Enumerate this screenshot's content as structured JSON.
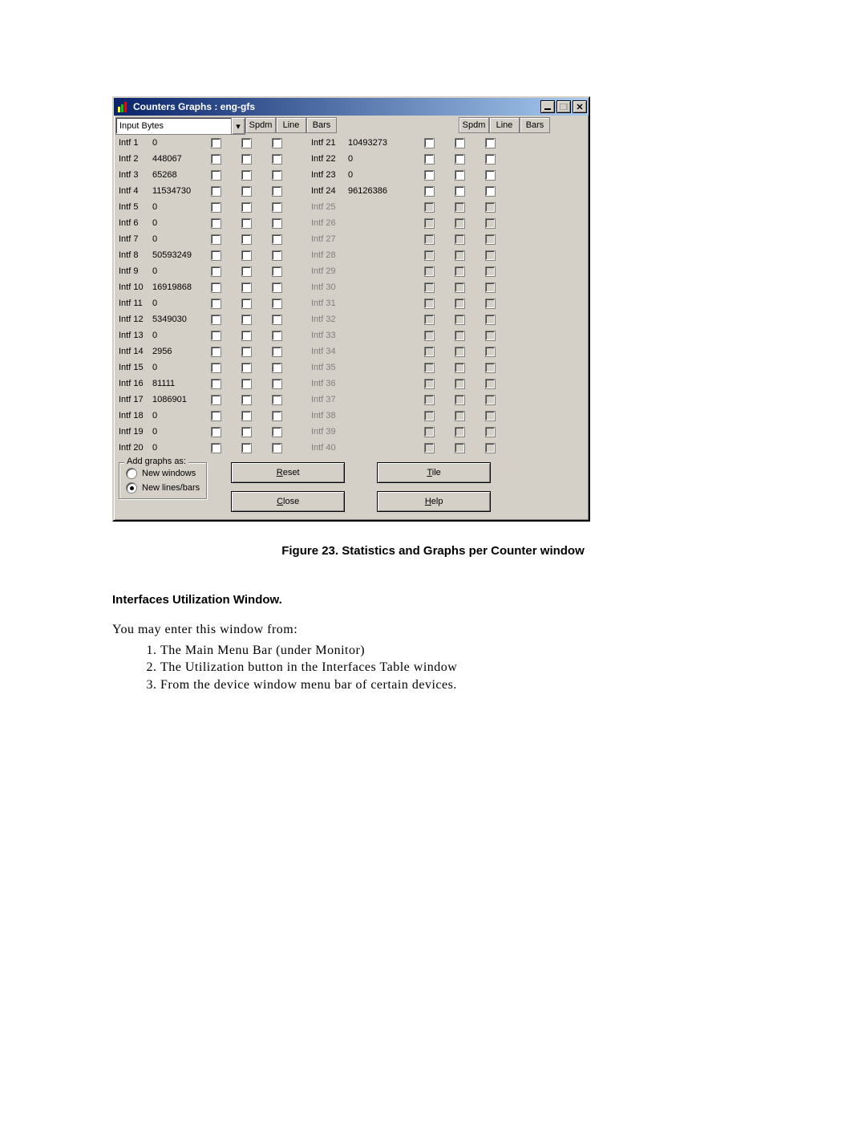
{
  "window": {
    "title": "Counters Graphs : eng-gfs",
    "dropdown_value": "Input Bytes",
    "headers": [
      "Spdm",
      "Line",
      "Bars",
      "Spdm",
      "Line",
      "Bars"
    ],
    "left_rows": [
      {
        "name": "Intf 1",
        "value": "0",
        "enabled": true
      },
      {
        "name": "Intf 2",
        "value": "448067",
        "enabled": true
      },
      {
        "name": "Intf 3",
        "value": "65268",
        "enabled": true
      },
      {
        "name": "Intf 4",
        "value": "11534730",
        "enabled": true
      },
      {
        "name": "Intf 5",
        "value": "0",
        "enabled": true
      },
      {
        "name": "Intf 6",
        "value": "0",
        "enabled": true
      },
      {
        "name": "Intf 7",
        "value": "0",
        "enabled": true
      },
      {
        "name": "Intf 8",
        "value": "50593249",
        "enabled": true
      },
      {
        "name": "Intf 9",
        "value": "0",
        "enabled": true
      },
      {
        "name": "Intf 10",
        "value": "16919868",
        "enabled": true
      },
      {
        "name": "Intf 11",
        "value": "0",
        "enabled": true
      },
      {
        "name": "Intf 12",
        "value": "5349030",
        "enabled": true
      },
      {
        "name": "Intf 13",
        "value": "0",
        "enabled": true
      },
      {
        "name": "Intf 14",
        "value": "2956",
        "enabled": true
      },
      {
        "name": "Intf 15",
        "value": "0",
        "enabled": true
      },
      {
        "name": "Intf 16",
        "value": "81111",
        "enabled": true
      },
      {
        "name": "Intf 17",
        "value": "1086901",
        "enabled": true
      },
      {
        "name": "Intf 18",
        "value": "0",
        "enabled": true
      },
      {
        "name": "Intf 19",
        "value": "0",
        "enabled": true
      },
      {
        "name": "Intf 20",
        "value": "0",
        "enabled": true
      }
    ],
    "right_rows": [
      {
        "name": "Intf 21",
        "value": "10493273",
        "enabled": true
      },
      {
        "name": "Intf 22",
        "value": "0",
        "enabled": true
      },
      {
        "name": "Intf 23",
        "value": "0",
        "enabled": true
      },
      {
        "name": "Intf 24",
        "value": "96126386",
        "enabled": true
      },
      {
        "name": "Intf 25",
        "value": "",
        "enabled": false
      },
      {
        "name": "Intf 26",
        "value": "",
        "enabled": false
      },
      {
        "name": "Intf 27",
        "value": "",
        "enabled": false
      },
      {
        "name": "Intf 28",
        "value": "",
        "enabled": false
      },
      {
        "name": "Intf 29",
        "value": "",
        "enabled": false
      },
      {
        "name": "Intf 30",
        "value": "",
        "enabled": false
      },
      {
        "name": "Intf 31",
        "value": "",
        "enabled": false
      },
      {
        "name": "Intf 32",
        "value": "",
        "enabled": false
      },
      {
        "name": "Intf 33",
        "value": "",
        "enabled": false
      },
      {
        "name": "Intf 34",
        "value": "",
        "enabled": false
      },
      {
        "name": "Intf 35",
        "value": "",
        "enabled": false
      },
      {
        "name": "Intf 36",
        "value": "",
        "enabled": false
      },
      {
        "name": "Intf 37",
        "value": "",
        "enabled": false
      },
      {
        "name": "Intf 38",
        "value": "",
        "enabled": false
      },
      {
        "name": "Intf 39",
        "value": "",
        "enabled": false
      },
      {
        "name": "Intf 40",
        "value": "",
        "enabled": false
      }
    ],
    "group": {
      "legend": "Add graphs as:",
      "opt1": "New windows",
      "opt2": "New lines/bars",
      "selected": 2
    },
    "buttons": {
      "reset": {
        "u": "R",
        "rest": "eset"
      },
      "close": {
        "u": "C",
        "rest": "lose"
      },
      "tile": {
        "u": "T",
        "rest": "ile"
      },
      "help": {
        "u": "H",
        "rest": "elp"
      }
    }
  },
  "caption": "Figure 23. Statistics and Graphs per Counter window",
  "section": "Interfaces Utilization Window.",
  "intro": "You may enter this window from:",
  "items": [
    "The Main Menu Bar (under Monitor)",
    "The Utilization button in the Interfaces Table window",
    "From the device window menu bar of certain devices."
  ]
}
